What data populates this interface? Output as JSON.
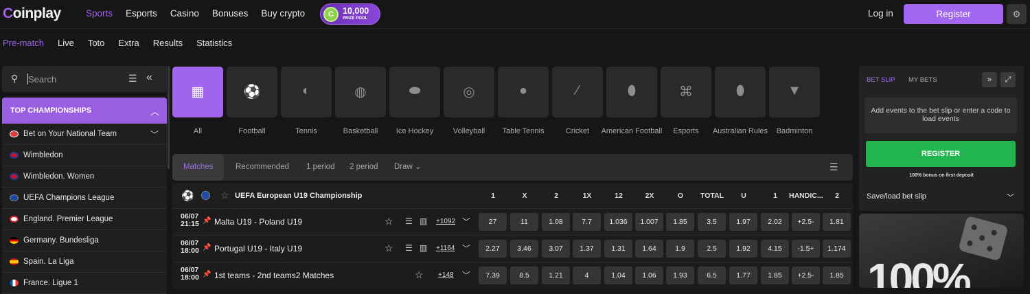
{
  "brand": {
    "logo": "Coinplay",
    "accent": "#a164ec",
    "green": "#22b44e"
  },
  "topnav": [
    "Sports",
    "Esports",
    "Casino",
    "Bonuses",
    "Buy crypto"
  ],
  "prize": {
    "amount": "10,000",
    "label": "PRIZE POOL"
  },
  "header": {
    "login": "Log in",
    "register": "Register",
    "settings_icon": "gear-icon"
  },
  "subnav": [
    "Pre-match",
    "Live",
    "Toto",
    "Extra",
    "Results",
    "Statistics"
  ],
  "search": {
    "placeholder": "Search"
  },
  "championships": {
    "title": "TOP CHAMPIONSHIPS",
    "items": [
      "Bet on Your National Team",
      "Wimbledon",
      "Wimbledon. Women",
      "UEFA Champions League",
      "England. Premier League",
      "Germany. Bundesliga",
      "Spain. La Liga",
      "France. Ligue 1"
    ]
  },
  "sports": [
    {
      "name": "All",
      "icon": "grid-icon"
    },
    {
      "name": "Football",
      "icon": "football-icon"
    },
    {
      "name": "Tennis",
      "icon": "tennis-icon"
    },
    {
      "name": "Basketball",
      "icon": "basketball-icon"
    },
    {
      "name": "Ice Hockey",
      "icon": "puck-icon"
    },
    {
      "name": "Volleyball",
      "icon": "volleyball-icon"
    },
    {
      "name": "Table Tennis",
      "icon": "paddle-icon"
    },
    {
      "name": "Cricket",
      "icon": "cricket-icon"
    },
    {
      "name": "American Football",
      "icon": "american-football-icon"
    },
    {
      "name": "Esports",
      "icon": "gamepad-icon"
    },
    {
      "name": "Australian Rules",
      "icon": "rugby-ball-icon"
    },
    {
      "name": "Badminton",
      "icon": "shuttlecock-icon"
    }
  ],
  "market_tabs": [
    "Matches",
    "Recommended",
    "1 period",
    "2 period",
    "Draw"
  ],
  "league": {
    "name": "UEFA European U19 Championship"
  },
  "columns": [
    "1",
    "X",
    "2",
    "1X",
    "12",
    "2X",
    "O",
    "TOTAL",
    "U",
    "1",
    "HANDIC...",
    "2"
  ],
  "matches": [
    {
      "date": "06/07",
      "time": "21:15",
      "teams": "Malta U19 - Poland U19",
      "more": "+1092",
      "odds": [
        "27",
        "11",
        "1.08",
        "7.7",
        "1.036",
        "1.007",
        "1.85",
        "3.5",
        "1.97",
        "2.02",
        "+2.5-",
        "1.81"
      ]
    },
    {
      "date": "06/07",
      "time": "18:00",
      "teams": "Portugal U19 - Italy U19",
      "more": "+1164",
      "odds": [
        "2.27",
        "3.46",
        "3.07",
        "1.37",
        "1.31",
        "1.64",
        "1.9",
        "2.5",
        "1.92",
        "4.15",
        "-1.5+",
        "1.174"
      ]
    },
    {
      "date": "06/07",
      "time": "18:00",
      "teams": "1st teams - 2nd teams2 Matches",
      "more": "+148",
      "odds": [
        "7.39",
        "8.5",
        "1.21",
        "4",
        "1.04",
        "1.06",
        "1.93",
        "6.5",
        "1.77",
        "1.85",
        "+2.5-",
        "1.85"
      ]
    }
  ],
  "betslip": {
    "tab_active": "BET SLIP",
    "tab_other": "MY BETS",
    "empty": "Add events to the bet slip or enter a code to load events",
    "register": "REGISTER",
    "bonus": "100% bonus on first deposit",
    "load": "Save/load bet slip"
  },
  "promo": {
    "text": "100%"
  }
}
